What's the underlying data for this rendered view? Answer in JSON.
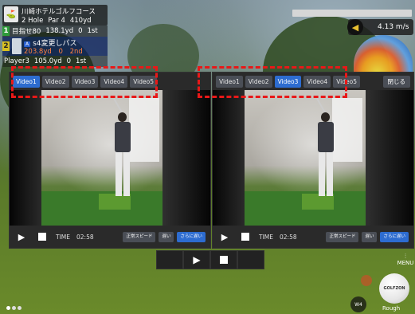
{
  "scoreboard": {
    "course": "川崎ホテルゴルフコース",
    "hole": "2 Hole",
    "par": "Par 4",
    "yardage": "410yd",
    "players": [
      {
        "num": "1",
        "name": "目指せ80",
        "dist": "138.1yd",
        "strokes": "0",
        "rank": "1st"
      },
      {
        "num": "2",
        "name": "s4変更しパス",
        "badge": "A",
        "dist": "203.8yd",
        "strokes": "0",
        "rank": "2nd"
      },
      {
        "num": "",
        "name": "Player3",
        "dist": "105.0yd",
        "strokes": "0",
        "rank": "1st"
      }
    ]
  },
  "wind": {
    "speed": "4.13 m/s",
    "icon": "wind-direction-arrow"
  },
  "left_panel": {
    "tabs": [
      "Video1",
      "Video2",
      "Video3",
      "Video4",
      "Video5"
    ],
    "active_tab": "Video1",
    "time_label": "TIME",
    "time": "02:58",
    "buttons": [
      "正常スピード",
      "遅い",
      "さらに遅い"
    ]
  },
  "right_panel": {
    "tabs": [
      "Video1",
      "Video2",
      "Video3",
      "Video4",
      "Video5"
    ],
    "active_tab": "Video3",
    "close_label": "閉じる",
    "time_label": "TIME",
    "time": "02:58",
    "buttons": [
      "正常スピード",
      "遅い",
      "さらに遅い"
    ]
  },
  "master_controls": {
    "play": "▶",
    "stop": "■"
  },
  "bottom_right": {
    "menu": "MENU",
    "ball": "GOLFZON",
    "club": "W4",
    "lie": "Rough"
  },
  "colors": {
    "active_tab": "#2d6cd0",
    "highlight": "#e81818",
    "panel_bg": "#1a1a1a"
  }
}
